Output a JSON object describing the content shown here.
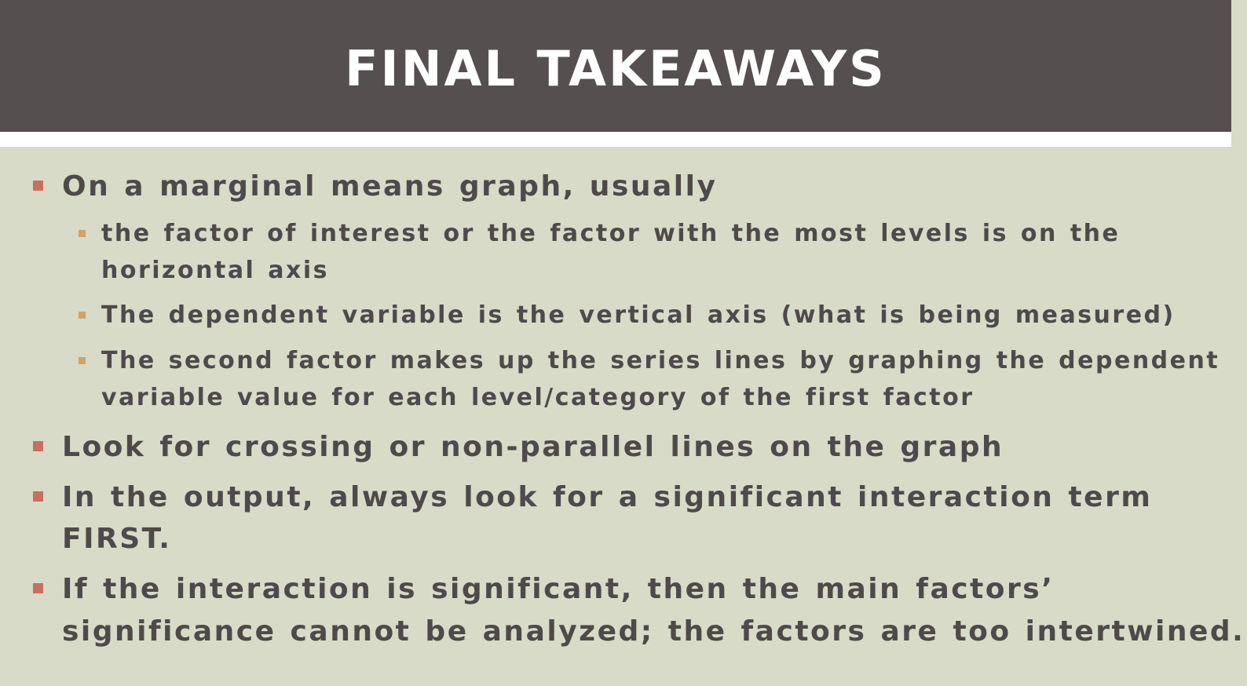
{
  "slide": {
    "title": "FINAL TAKEAWAYS",
    "bullets": [
      {
        "text": "On a marginal means graph, usually",
        "sub": [
          {
            "line1": "the factor of interest or the factor with the most levels is on the",
            "line2": "horizontal axis"
          },
          {
            "line1": "The dependent variable is the vertical axis (what is being measured)"
          },
          {
            "line1": "The second factor makes up the series lines by graphing the dependent",
            "line2": "variable value for each level/category of the first factor"
          }
        ]
      },
      {
        "line1": "Look for crossing or non-parallel lines on the graph"
      },
      {
        "line1": "In the output, always look for a significant interaction term",
        "line2": "FIRST."
      },
      {
        "line1": "If the interaction is significant, then the main factors’",
        "line2": "significance cannot be analyzed; the factors are too intertwined."
      }
    ]
  },
  "colors": {
    "title_bar": "#564f50",
    "background": "#d7dbc8",
    "main_bullet": "#c96f5f",
    "sub_bullet": "#d0a46a",
    "text": "#4f4a4a"
  }
}
